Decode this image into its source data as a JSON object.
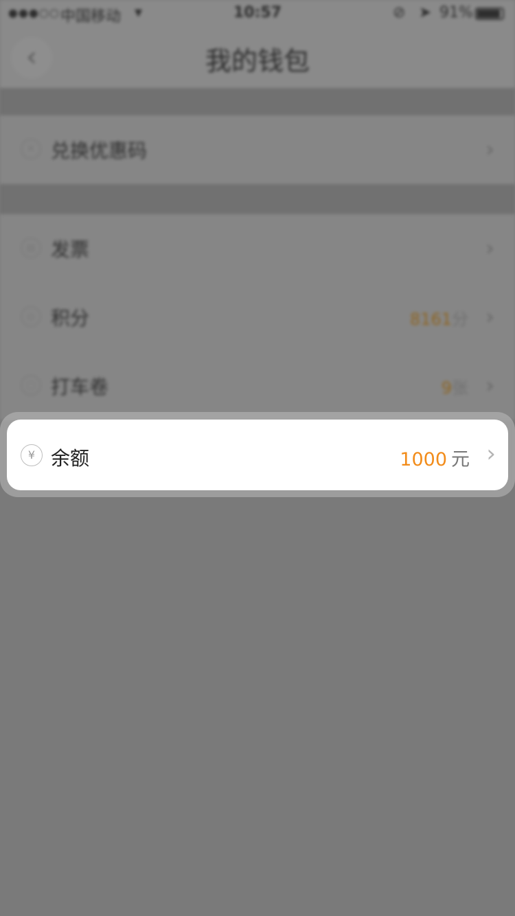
{
  "status_bar": {
    "signal": "●●●○○",
    "carrier": "中国移动",
    "wifi": "▾",
    "time": "10:57",
    "icons": [
      "lock-rotation-icon",
      "location-arrow-icon"
    ],
    "battery": "91%",
    "battery_level": 0.91
  },
  "nav": {
    "back_icon": "chevron-left-icon",
    "title": "我的钱包"
  },
  "groups": [
    {
      "items": [
        {
          "label": "兑换优惠码",
          "icon": "coupon-code-icon",
          "value": "",
          "unit": ""
        }
      ]
    },
    {
      "items": [
        {
          "label": "发票",
          "icon": "invoice-icon",
          "value": "",
          "unit": ""
        },
        {
          "label": "积分",
          "icon": "points-icon",
          "value": "8161",
          "unit": "分"
        },
        {
          "label": "打车卷",
          "icon": "ticket-icon",
          "value": "9",
          "unit": "张"
        }
      ]
    }
  ],
  "focused_item": {
    "label": "余额",
    "icon_glyph": "¥",
    "icon": "yuan-icon",
    "amount": "1000",
    "unit": "元"
  },
  "colors": {
    "overlay": "#7a7a7a",
    "accent": "#f28c1a",
    "card": "#ffffff"
  }
}
